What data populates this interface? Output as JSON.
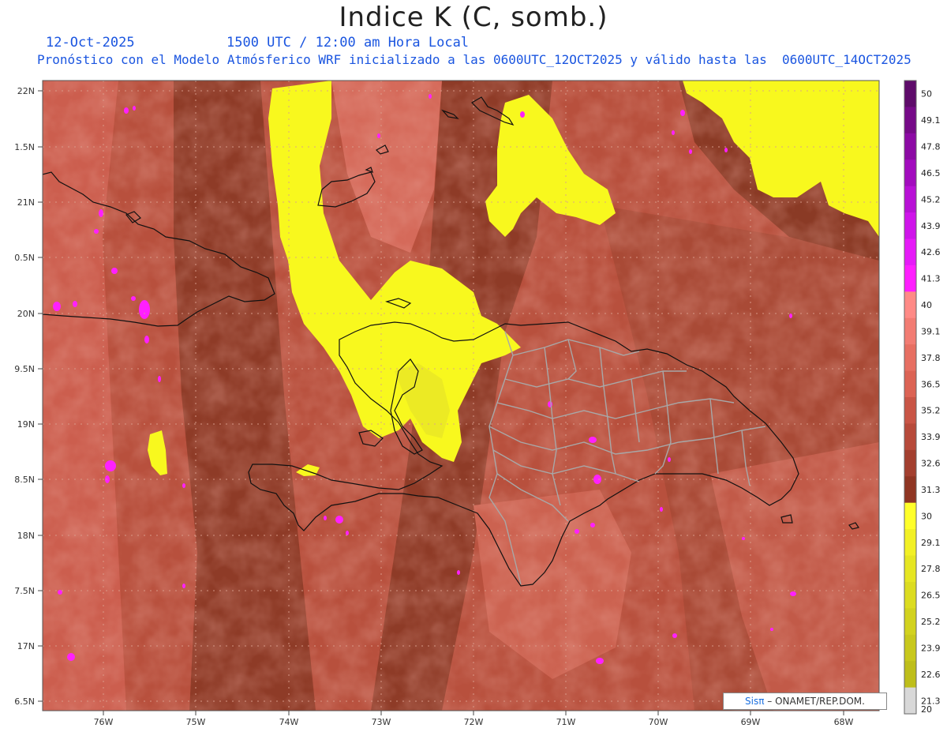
{
  "header": {
    "title": "Indice K (C, somb.)",
    "date": "12-Oct-2025",
    "time": "1500 UTC / 12:00 am Hora Local",
    "description": "Pronóstico con el Modelo Atmósferico WRF inicializado a las 0600UTC_12OCT2025 y válido hasta las  0600UTC_14OCT2025"
  },
  "map": {
    "lat_labels": [
      "22N",
      "1.5N",
      "21N",
      "0.5N",
      "20N",
      "9.5N",
      "19N",
      "8.5N",
      "18N",
      "7.5N",
      "17N",
      "6.5N"
    ],
    "lon_labels": [
      "76W",
      "75W",
      "74W",
      "73W",
      "72W",
      "71W",
      "70W",
      "69W",
      "68W"
    ],
    "colors": {
      "dark_brown": "#8a3a25",
      "mid_brown": "#b8503d",
      "salmon": "#d5685a",
      "light_salmon": "#e0806e",
      "yellow": "#f8f81e",
      "magenta": "#ff20ff"
    }
  },
  "colorbar": {
    "labels": [
      "50",
      "49.1",
      "47.8",
      "46.5",
      "45.2",
      "43.9",
      "42.6",
      "41.3",
      "40",
      "39.1",
      "37.8",
      "36.5",
      "35.2",
      "33.9",
      "32.6",
      "31.3",
      "30",
      "29.1",
      "27.8",
      "26.5",
      "25.2",
      "23.9",
      "22.6",
      "21.3",
      "20"
    ],
    "colors": [
      "#5e0b6a",
      "#760a88",
      "#8c0aa4",
      "#a20cbe",
      "#b810d6",
      "#cf14ea",
      "#e61af8",
      "#ff1eff",
      "#ff8a86",
      "#f27c73",
      "#e76f62",
      "#dc6354",
      "#c95546",
      "#b74a3a",
      "#a33f2f",
      "#8f3523",
      "#ffff2a",
      "#f2f025",
      "#e6e622",
      "#dcdc20",
      "#d2d21e",
      "#c8c81c",
      "#bebe1a",
      "#d8d8d8"
    ]
  },
  "credit": {
    "sis": "Sisπ",
    "rest": "– ONAMET/REP.DOM."
  }
}
